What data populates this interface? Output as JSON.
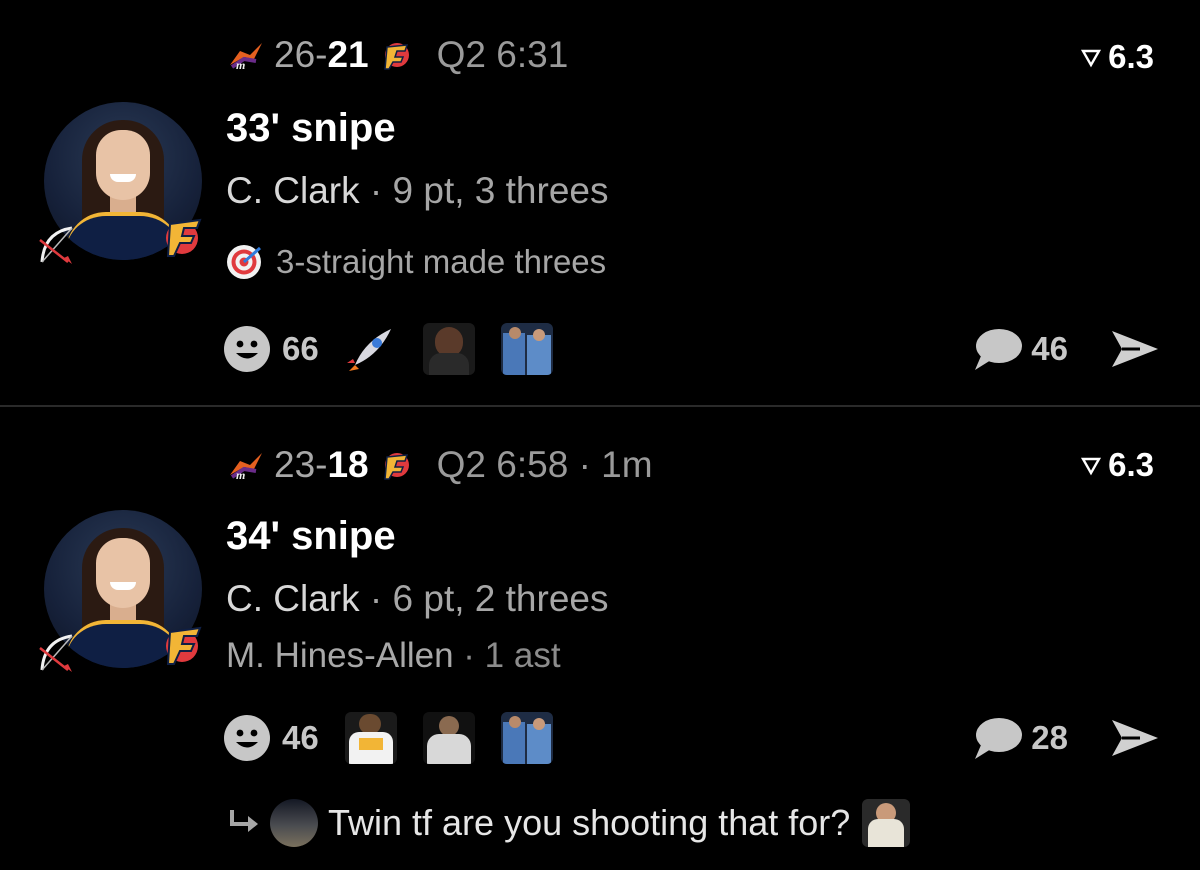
{
  "posts": [
    {
      "score_away": "26-",
      "score_home": "21",
      "clock": "Q2 6:31",
      "rating": "6.3",
      "title": "33' snipe",
      "player": "C. Clark",
      "player_stats": " · 9 pt, 3 threes",
      "achievement": "3-straight made threes",
      "reactions_count": "66",
      "comments_count": "46"
    },
    {
      "score_away": "23-",
      "score_home": "18",
      "clock": "Q2 6:58 · 1m",
      "rating": "6.3",
      "title": "34' snipe",
      "player": "C. Clark",
      "player_stats": " · 6 pt, 2 threes",
      "assist_player": "M. Hines-Allen",
      "assist_stats": " · 1 ast",
      "reactions_count": "46",
      "comments_count": "28",
      "reply_text": "Twin tf are you shooting that for?"
    }
  ],
  "icons": {
    "away_team": "mercury-logo-icon",
    "home_team": "fever-logo-icon",
    "rating": "triangle-down-icon",
    "achievement": "target-icon",
    "reaction": "smiley-face-icon",
    "comment": "speech-bubble-icon",
    "share": "send-arrow-icon",
    "reply": "reply-arrow-icon"
  },
  "colors": {
    "background": "#000000",
    "muted_text": "#a6a6a6",
    "divider": "#2a2a2a",
    "fever_red": "#e03a3e",
    "fever_gold": "#f2b536",
    "mercury_orange": "#e56020"
  }
}
